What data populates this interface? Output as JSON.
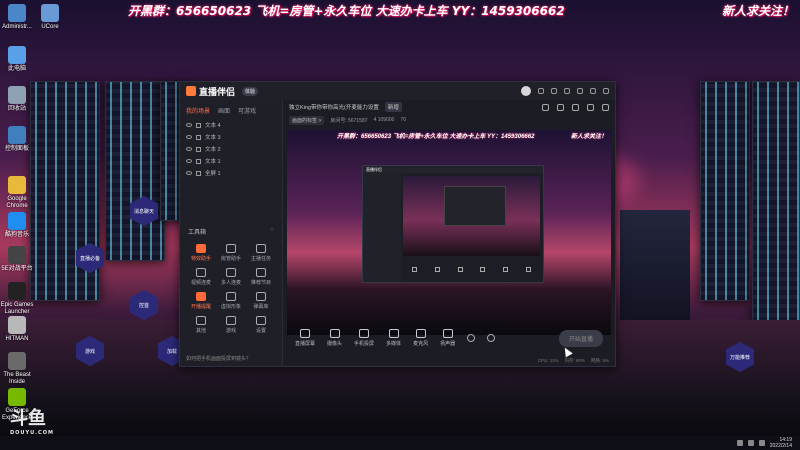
{
  "banner": {
    "left": "开黑群：656650623 飞机=房管+永久车位 大速办卡上车 YY：1459306662",
    "right": "新人求关注！"
  },
  "desktop_icons": [
    {
      "label": "Administr...",
      "color": "#4b86c9"
    },
    {
      "label": "此电脑",
      "color": "#5aa0e8"
    },
    {
      "label": "回收站",
      "color": "#8fa2b3"
    },
    {
      "label": "控制面板",
      "color": "#3f7fbf"
    },
    {
      "label": "Google Chrome",
      "color": "#e8b93a"
    },
    {
      "label": "酷狗音乐",
      "color": "#1f8ef0"
    },
    {
      "label": "5E对战平台",
      "color": "#444"
    },
    {
      "label": "Epic Games Launcher",
      "color": "#222"
    },
    {
      "label": "HITMAN",
      "color": "#b8b8b8"
    },
    {
      "label": "The Beast Inside",
      "color": "#6a6a6a"
    },
    {
      "label": "GeForce Experience",
      "color": "#76b900"
    }
  ],
  "desktop_icon_2": {
    "label": "UCore",
    "color": "#6a9ad6"
  },
  "hex_buttons": [
    "消息聊天",
    "直播必备",
    "控首",
    "游戏",
    "加载",
    "直播",
    "万能推荐"
  ],
  "app": {
    "title": "直播伴侣",
    "version_badge": "体验",
    "side_tabs": [
      "我的场景",
      "画面",
      "可游戏"
    ],
    "sources": [
      "文本 4",
      "文本 3",
      "文本 2",
      "文本 1",
      "全屏 1"
    ],
    "tools_title": "工具箱",
    "tools": [
      {
        "label": "特效助手",
        "hot": true
      },
      {
        "label": "房管助手",
        "hot": false
      },
      {
        "label": "主播任务",
        "hot": false
      },
      {
        "label": "视频连麦",
        "hot": false
      },
      {
        "label": "多人连麦",
        "hot": false
      },
      {
        "label": "推荐节目",
        "hot": false
      },
      {
        "label": "开播提醒",
        "hot": true
      },
      {
        "label": "虚拟形象",
        "hot": false
      },
      {
        "label": "弹幕库",
        "hot": false
      },
      {
        "label": "其他",
        "hot": false
      },
      {
        "label": "游戏",
        "hot": false
      },
      {
        "label": "设置",
        "hot": false
      }
    ],
    "side_footer": "如何把手机画面投屏到镜头？",
    "room_title": "独立King带你带你高光(开麦能力设置",
    "room_tag": "新增",
    "room_sub": [
      "画面的标签 >",
      "房间号: 5671587",
      "4 109000",
      "70"
    ],
    "controls": [
      "直播屏幕",
      "摄像头",
      "手机投屏",
      "多媒体",
      "麦克风",
      "扬声器"
    ],
    "go_live_label": "开始直播",
    "status": [
      "CPU: 11%",
      "内存: 50%",
      "网络: 5%"
    ]
  },
  "preview_banner": {
    "left": "开黑群：656650623 飞机=房管+永久车位 大速办卡上车 YY：1459306662",
    "right": "新人求关注！"
  },
  "watermark": {
    "brand": "斗鱼",
    "url": "DOUYU.COM"
  },
  "taskbar": {
    "time": "14:19",
    "date": "2022/2/14"
  }
}
